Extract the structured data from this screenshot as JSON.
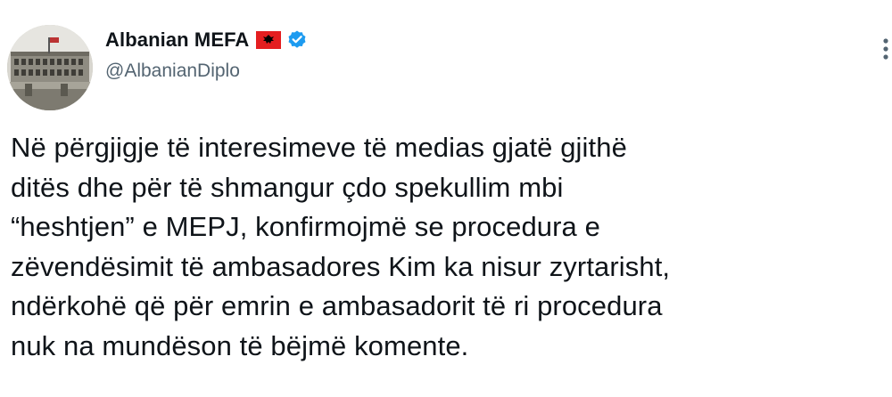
{
  "account": {
    "display_name": "Albanian MEFA",
    "handle": "@AlbanianDiplo",
    "flag_icon": "albania-flag-icon",
    "verified_icon": "verified-badge-icon",
    "verified_color": "#1d9bf0"
  },
  "menu": {
    "icon": "more-options-icon"
  },
  "tweet": {
    "text": "Në përgjigje të interesimeve të medias gjatë gjithë\nditës dhe për të shmangur çdo spekullim mbi\n“heshtjen” e MEPJ, konfirmojmë se procedura e\nzëvendësimit të ambasadores Kim ka nisur zyrtarisht,\nndërkohë që për emrin e ambasadorit të ri procedura\nnuk na mundëson të bëjmë komente."
  },
  "colors": {
    "text": "#0f1419",
    "secondary_text": "#536471",
    "flag_red": "#e41e20",
    "flag_eagle": "#000000"
  }
}
